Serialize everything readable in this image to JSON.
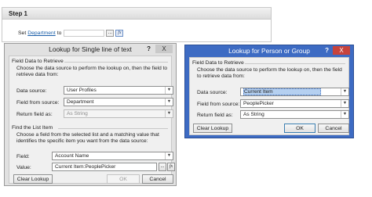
{
  "step": {
    "title": "Step 1",
    "sentence_pre": "Set",
    "sentence_link": "Department",
    "sentence_post": "to",
    "lookup_btn": "...",
    "fx_btn": "fx"
  },
  "left_dialog": {
    "title": "Lookup for Single line of text",
    "help": "?",
    "close": "X",
    "field_data_title": "Field Data to Retrieve",
    "field_data_desc": "Choose the data source to perform the lookup on, then the field to retrieve data from:",
    "data_source_label": "Data source:",
    "data_source_value": "User Profiles",
    "field_from_source_label": "Field from source:",
    "field_from_source_value": "Department",
    "return_field_label": "Return field as:",
    "return_field_value": "As String",
    "find_item_title": "Find the List Item",
    "find_item_desc": "Choose a field from the selected list and a matching value that identifies the specific item you want from the data source:",
    "field_label": "Field:",
    "field_value": "Account Name",
    "value_label": "Value:",
    "value_value": "Current Item:PeoplePicker",
    "value_lookup_btn": "...",
    "value_fx_btn": "fx",
    "clear_btn": "Clear Lookup",
    "ok_btn": "OK",
    "cancel_btn": "Cancel"
  },
  "right_dialog": {
    "title": "Lookup for Person or Group",
    "help": "?",
    "close": "X",
    "field_data_title": "Field Data to Retrieve",
    "field_data_desc": "Choose the data source to perform the lookup on, then the field to retrieve data from:",
    "data_source_label": "Data source:",
    "data_source_value": "Current Item",
    "field_from_source_label": "Field from source:",
    "field_from_source_value": "PeoplePicker",
    "return_field_label": "Return field as:",
    "return_field_value": "As String",
    "clear_btn": "Clear Lookup",
    "ok_btn": "OK",
    "cancel_btn": "Cancel"
  }
}
